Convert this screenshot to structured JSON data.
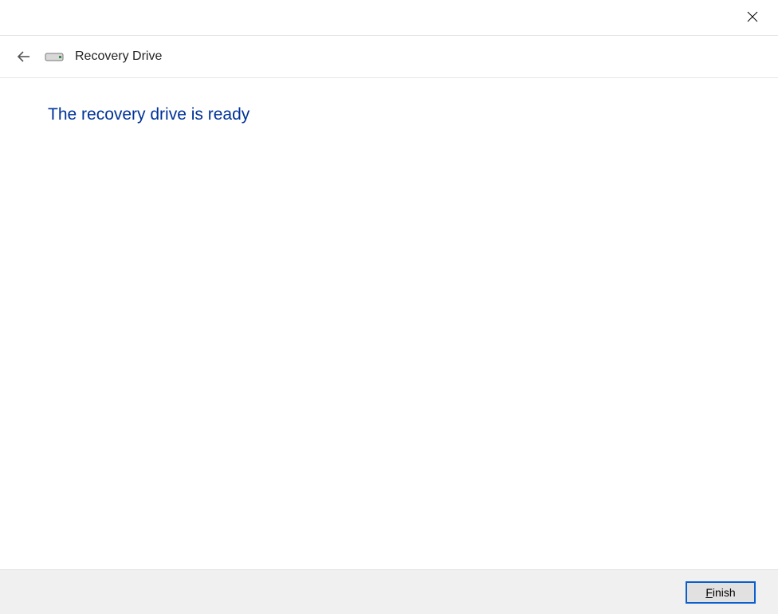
{
  "header": {
    "title": "Recovery Drive"
  },
  "main": {
    "heading": "The recovery drive is ready"
  },
  "footer": {
    "finish_label": "Finish"
  }
}
